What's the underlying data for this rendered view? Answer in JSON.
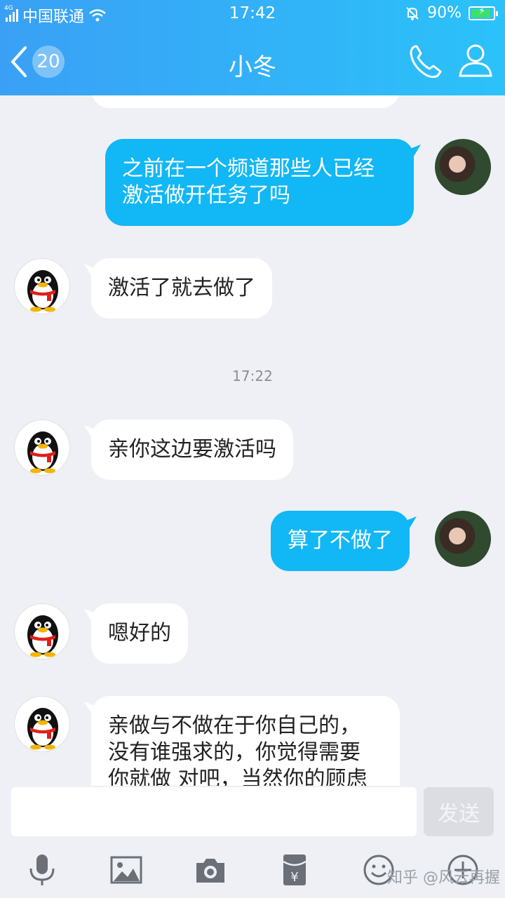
{
  "status_bar": {
    "network": "4G",
    "carrier": "中国联通",
    "time": "17:42",
    "battery": "90%",
    "battery_level": 0.9
  },
  "nav": {
    "unread_count": "20",
    "contact_name": "小冬",
    "icons": [
      "back-arrow-icon",
      "phone-icon",
      "person-icon"
    ]
  },
  "messages": [
    {
      "side": "right",
      "text_lines": [
        "之前在一个频道那些人已经",
        "激活做开任务了吗"
      ]
    },
    {
      "side": "left",
      "text": "激活了就去做了"
    },
    {
      "time": "17:22"
    },
    {
      "side": "left",
      "text": "亲你这边要激活吗"
    },
    {
      "side": "right",
      "text": "算了不做了"
    },
    {
      "side": "left",
      "text": "嗯好的"
    },
    {
      "side": "left",
      "text_lines": [
        "亲做与不做在于你自己的，",
        "没有谁强求的，你觉得需要",
        "你就做 对吧，当然你的顾虑"
      ]
    }
  ],
  "input": {
    "value": "",
    "send_label": "发送"
  },
  "toolbar_icons": [
    "microphone-icon",
    "image-icon",
    "camera-icon",
    "red-packet-icon",
    "emoji-icon",
    "plus-icon"
  ],
  "watermark": "知乎 @风云再握",
  "colors": {
    "header_start": "#3aa0f5",
    "header_end": "#2bc2fa",
    "bubble_out": "#12b7f5",
    "bubble_in": "#ffffff",
    "background": "#eef0f6"
  }
}
